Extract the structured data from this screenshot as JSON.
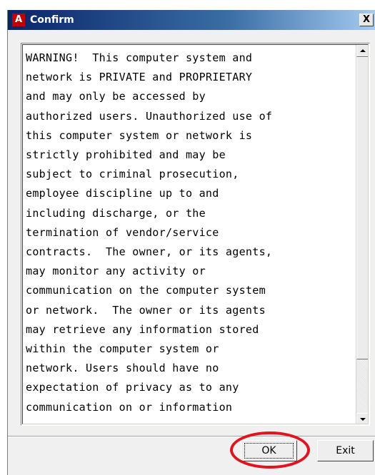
{
  "window": {
    "title": "Confirm",
    "app_icon_glyph": "A",
    "app_icon": "app-logo-icon",
    "close_glyph": "X",
    "close_icon": "close-icon"
  },
  "message": {
    "text": "WARNING!  This computer system and\nnetwork is PRIVATE and PROPRIETARY\nand may only be accessed by\nauthorized users. Unauthorized use of\nthis computer system or network is\nstrictly prohibited and may be\nsubject to criminal prosecution,\nemployee discipline up to and\nincluding discharge, or the\ntermination of vendor/service\ncontracts.  The owner, or its agents,\nmay monitor any activity or\ncommunication on the computer system\nor network.  The owner or its agents\nmay retrieve any information stored\nwithin the computer system or\nnetwork. Users should have no\nexpectation of privacy as to any\ncommunication on or information"
  },
  "scrollbar": {
    "up_icon": "scroll-up-arrow-icon",
    "down_icon": "scroll-down-arrow-icon"
  },
  "buttons": {
    "ok_label": "OK",
    "exit_label": "Exit"
  },
  "colors": {
    "highlight_ring": "#e0141e",
    "title_bar_start": "#0a246a",
    "app_icon_bg": "#c00000"
  }
}
